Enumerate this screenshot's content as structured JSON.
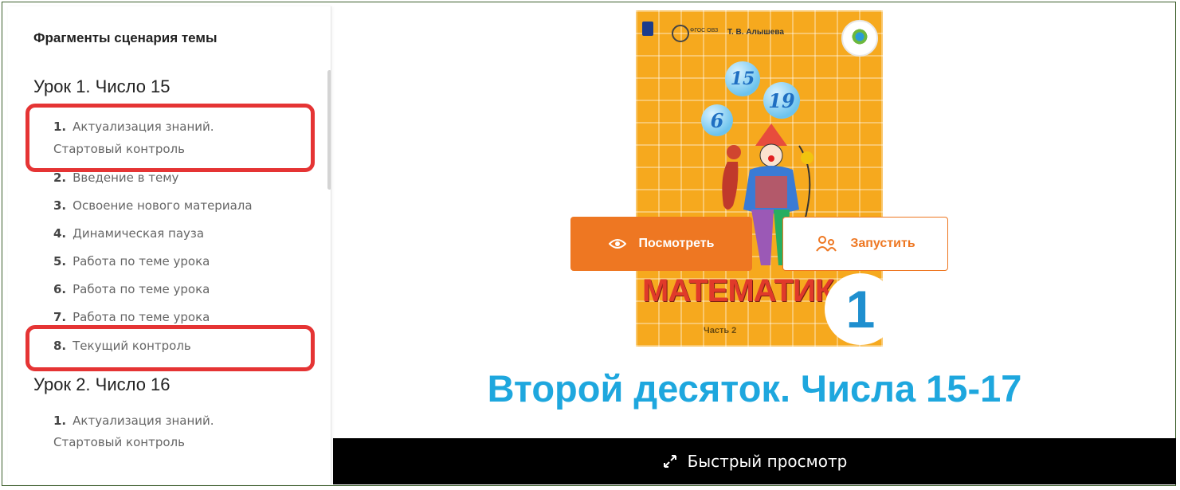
{
  "sidebar": {
    "title": "Фрагменты сценария темы",
    "lessons": [
      {
        "title": "Урок 1. Число 15",
        "items": [
          {
            "num": "1.",
            "label": "Актуализация знаний.",
            "cont": "Стартовый контроль"
          },
          {
            "num": "2.",
            "label": "Введение в тему"
          },
          {
            "num": "3.",
            "label": "Освоение нового материала"
          },
          {
            "num": "4.",
            "label": "Динамическая пауза"
          },
          {
            "num": "5.",
            "label": "Работа по теме урока"
          },
          {
            "num": "6.",
            "label": "Работа по теме урока"
          },
          {
            "num": "7.",
            "label": "Работа по теме урока"
          },
          {
            "num": "8.",
            "label": "Текущий контроль"
          }
        ]
      },
      {
        "title": "Урок 2. Число 16",
        "items": [
          {
            "num": "1.",
            "label": "Актуализация знаний.",
            "cont": "Стартовый контроль"
          }
        ]
      }
    ],
    "highlight_color": "#e53434"
  },
  "cover": {
    "author": "Т. В. Алышева",
    "fgos": "ФГОС ОВЗ",
    "title": "МАТЕМАТИКА",
    "grade": "1",
    "part": "Часть 2",
    "numbers": [
      "15",
      "19",
      "6"
    ],
    "background": "#f6a91e"
  },
  "actions": {
    "view_label": "Посмотреть",
    "run_label": "Запустить",
    "accent": "#ee7722"
  },
  "topic_title": "Второй десяток. Числа 15-17",
  "topic_color": "#1ea7de",
  "quick_view_label": "Быстрый просмотр"
}
